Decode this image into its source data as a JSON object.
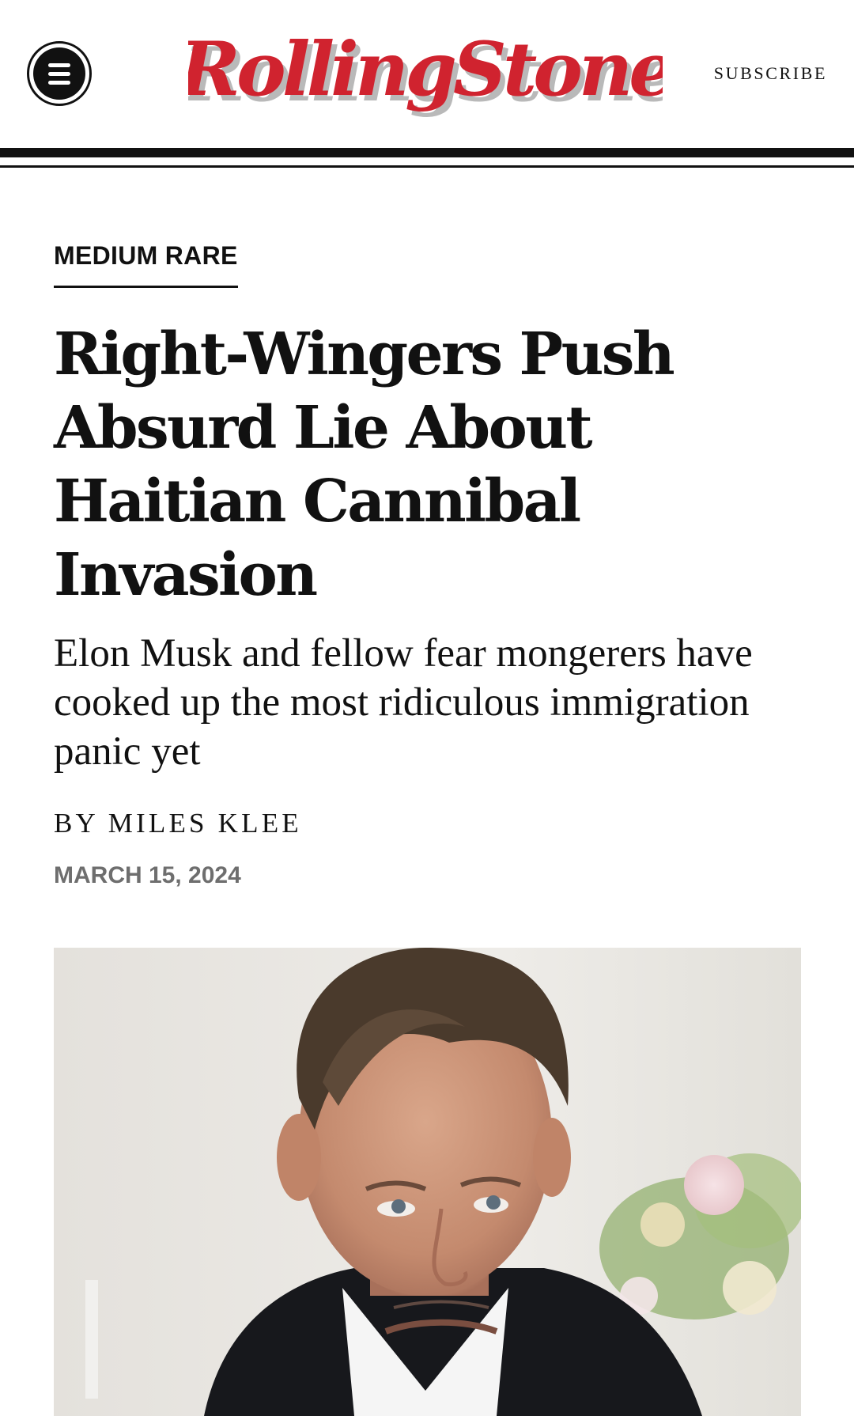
{
  "header": {
    "logo_text": "RollingStone",
    "subscribe_label": "SUBSCRIBE"
  },
  "article": {
    "kicker": "MEDIUM RARE",
    "headline": "Right-Wingers Push Absurd Lie About Haitian Cannibal Invasion",
    "dek": "Elon Musk and fellow fear mongerers have cooked up the most ridiculous immigration panic yet",
    "byline_prefix": "BY",
    "author": "MILES KLEE",
    "date": "MARCH 15, 2024"
  },
  "colors": {
    "brand_red": "#d0232f",
    "logo_shadow": "#b9b9b9",
    "text": "#111111",
    "date_gray": "#6e6e6e"
  },
  "icons": {
    "menu": "hamburger-menu-icon"
  }
}
